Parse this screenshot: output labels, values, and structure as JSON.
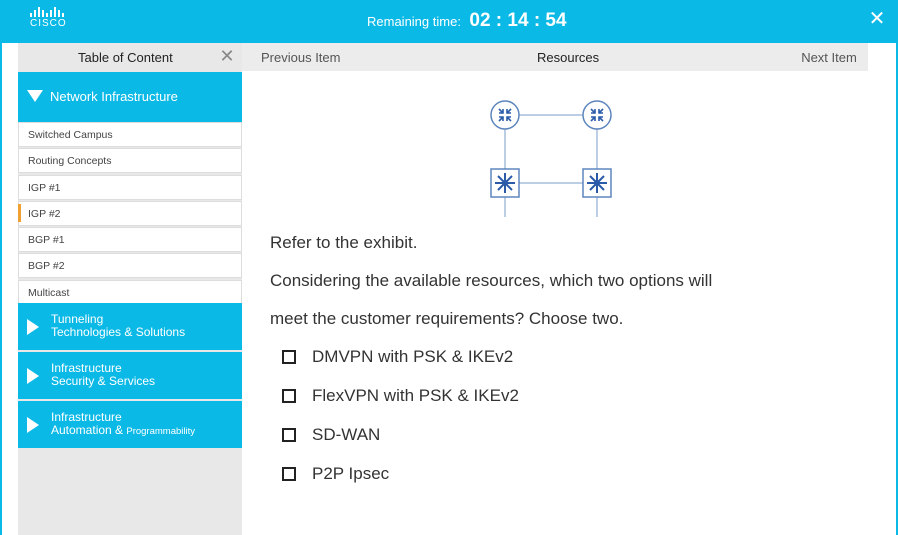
{
  "brand": {
    "logo_text": "CISCO"
  },
  "timer": {
    "label": "Remaining time:",
    "value": "02 : 14 : 54"
  },
  "sidebar": {
    "title": "Table of Content",
    "active_section": {
      "label": "Network Infrastructure"
    },
    "sub_items": [
      {
        "label": "Switched Campus"
      },
      {
        "label": "Routing Concepts"
      },
      {
        "label": "IGP #1"
      },
      {
        "label": "IGP #2"
      },
      {
        "label": "BGP #1"
      },
      {
        "label": "BGP #2"
      },
      {
        "label": "Multicast"
      }
    ],
    "sections": [
      {
        "line1": "Tunneling",
        "line2": "Technologies & Solutions"
      },
      {
        "line1": "Infrastructure",
        "line2": "Security & Services"
      },
      {
        "line1": "Infrastructure",
        "line2": "Automation & ",
        "line2b": "Programmability"
      }
    ]
  },
  "nav": {
    "previous": "Previous Item",
    "title": "Resources",
    "next": "Next Item"
  },
  "question": {
    "line1": "Refer to the exhibit.",
    "line2": "Considering the available resources, which two options will",
    "line3": "meet the customer requirements? Choose two.",
    "options": [
      "DMVPN with PSK & IKEv2",
      "FlexVPN with PSK & IKEv2",
      "SD-WAN",
      "P2P Ipsec"
    ]
  },
  "colors": {
    "accent": "#0bb9e6",
    "current_marker": "#f0a030"
  }
}
